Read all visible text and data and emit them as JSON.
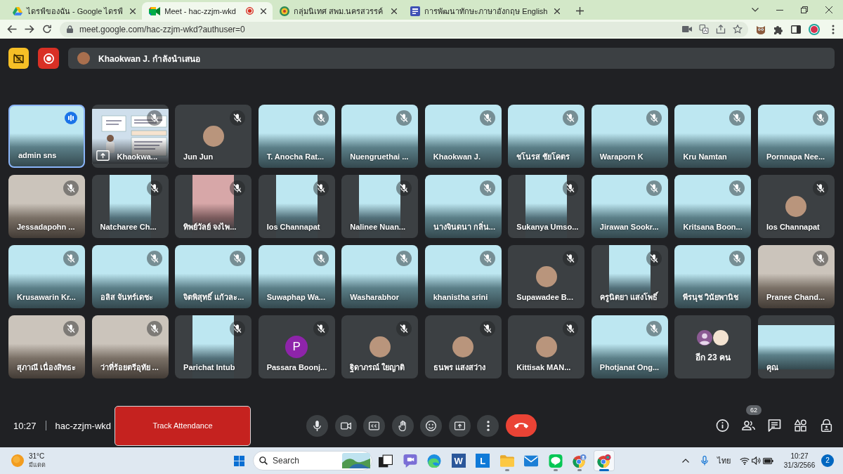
{
  "browser": {
    "tabs": [
      {
        "kind": "drive",
        "title": "ไดรฟ์ของฉัน - Google ไดรฟ์",
        "selected": false,
        "recording": false
      },
      {
        "kind": "meet",
        "title": "Meet - hac-zzjm-wkd",
        "selected": true,
        "recording": true
      },
      {
        "kind": "emblem",
        "title": "กลุ่มนิเทศ สพม.นครสวรรค์",
        "selected": false,
        "recording": false
      },
      {
        "kind": "page",
        "title": "การพัฒนาทักษะภาษาอังกฤษ English",
        "selected": false,
        "recording": false
      }
    ],
    "address": "meet.google.com/hac-zzjm-wkd?authuser=0"
  },
  "meet": {
    "presenter_banner": "Khaokwan J. กำลังนำเสนอ",
    "tiles": [
      {
        "name": "admin sns",
        "kind": "video",
        "virtual_background": true,
        "muted": false,
        "speaking": true
      },
      {
        "name": "Khaokwa...",
        "kind": "presentation",
        "muted": true,
        "speaking": false
      },
      {
        "name": "Jun Jun",
        "kind": "avatar",
        "muted": true,
        "speaking": false
      },
      {
        "name": "T. Anocha Rat...",
        "kind": "video",
        "virtual_background": true,
        "muted": true,
        "speaking": false
      },
      {
        "name": "Nuengruethai ...",
        "kind": "video",
        "virtual_background": true,
        "muted": true,
        "speaking": false
      },
      {
        "name": "Khaokwan J.",
        "kind": "video",
        "virtual_background": true,
        "muted": true,
        "speaking": false
      },
      {
        "name": "ชโนรส ชัยโคตร",
        "kind": "video",
        "virtual_background": true,
        "muted": true,
        "speaking": false
      },
      {
        "name": "Waraporn K",
        "kind": "video",
        "virtual_background": true,
        "muted": true,
        "speaking": false
      },
      {
        "name": "Kru Namtan",
        "kind": "video",
        "virtual_background": true,
        "muted": true,
        "speaking": false
      },
      {
        "name": "Pornnapa Nee...",
        "kind": "video",
        "virtual_background": true,
        "muted": true,
        "speaking": false
      },
      {
        "name": "Jessadapohn ...",
        "kind": "video",
        "virtual_background": false,
        "muted": true,
        "speaking": false
      },
      {
        "name": "Natcharee Ch...",
        "kind": "video-narrow",
        "virtual_background": true,
        "muted": true,
        "speaking": false
      },
      {
        "name": "ทิพย์วัลย์ จงไพ...",
        "kind": "video-narrow",
        "virtual_background": false,
        "muted": true,
        "speaking": false
      },
      {
        "name": "Ios Channapat",
        "kind": "video-narrow",
        "virtual_background": true,
        "muted": true,
        "speaking": false
      },
      {
        "name": "Nalinee Nuan...",
        "kind": "video-narrow",
        "virtual_background": true,
        "muted": true,
        "speaking": false
      },
      {
        "name": "นางจินดนา กลิ่น...",
        "kind": "video",
        "virtual_background": true,
        "muted": true,
        "speaking": false
      },
      {
        "name": "Sukanya Umso...",
        "kind": "video-narrow",
        "virtual_background": true,
        "muted": true,
        "speaking": false
      },
      {
        "name": "Jirawan Sookr...",
        "kind": "video",
        "virtual_background": true,
        "muted": true,
        "speaking": false
      },
      {
        "name": "Kritsana Boon...",
        "kind": "video",
        "virtual_background": true,
        "muted": true,
        "speaking": false
      },
      {
        "name": "Ios Channapat",
        "kind": "avatar",
        "muted": true,
        "speaking": false
      },
      {
        "name": "Krusawarin Kr...",
        "kind": "video",
        "virtual_background": true,
        "muted": true,
        "speaking": false
      },
      {
        "name": "อลิส จันทร์เดชะ",
        "kind": "video",
        "virtual_background": true,
        "muted": true,
        "speaking": false
      },
      {
        "name": "จิตพิสุทธิ์ แก้วละ...",
        "kind": "video",
        "virtual_background": true,
        "muted": true,
        "speaking": false
      },
      {
        "name": "Suwaphap Wa...",
        "kind": "video",
        "virtual_background": true,
        "muted": true,
        "speaking": false
      },
      {
        "name": "Washarabhor",
        "kind": "video",
        "virtual_background": true,
        "muted": true,
        "speaking": false
      },
      {
        "name": "khanistha srini",
        "kind": "video",
        "virtual_background": true,
        "muted": true,
        "speaking": false
      },
      {
        "name": "Supawadee B...",
        "kind": "avatar",
        "muted": true,
        "speaking": false
      },
      {
        "name": "ครูนิตยา แสงโพธิ์",
        "kind": "video-narrow",
        "virtual_background": true,
        "muted": true,
        "speaking": false
      },
      {
        "name": "พีรนุช วินัยพานิช",
        "kind": "video",
        "virtual_background": true,
        "muted": true,
        "speaking": false
      },
      {
        "name": "Pranee Chand...",
        "kind": "video",
        "virtual_background": false,
        "muted": true,
        "speaking": false
      },
      {
        "name": "สุภาณี เนื่องสิทธะ",
        "kind": "video",
        "virtual_background": false,
        "muted": true,
        "speaking": false
      },
      {
        "name": "ว่าที่ร้อยตรีอุทัย ...",
        "kind": "video",
        "virtual_background": false,
        "muted": true,
        "speaking": false
      },
      {
        "name": "Parichat Intub",
        "kind": "video-narrow",
        "virtual_background": true,
        "muted": true,
        "speaking": false
      },
      {
        "name": "Passara Boonj...",
        "kind": "letter",
        "initial": "P",
        "muted": true,
        "speaking": false
      },
      {
        "name": "ฐิดาภรณ์ ใยญาติ",
        "kind": "avatar",
        "muted": true,
        "speaking": false
      },
      {
        "name": "ธนพร แสงสว่าง",
        "kind": "avatar",
        "muted": true,
        "speaking": false
      },
      {
        "name": "Kittisak MAN...",
        "kind": "avatar",
        "muted": true,
        "speaking": false
      },
      {
        "name": "Photjanat Ong...",
        "kind": "video",
        "virtual_background": true,
        "muted": true,
        "speaking": false
      },
      {
        "name": "อีก 23 คน",
        "kind": "overflow",
        "muted": false,
        "speaking": false
      },
      {
        "name": "คุณ",
        "kind": "video-letterbox",
        "virtual_background": true,
        "muted": false,
        "speaking": false
      }
    ],
    "footer": {
      "time": "10:27",
      "meeting_code": "hac-zzjm-wkd",
      "attendance_button": "Track Attendance",
      "people_count": "62"
    }
  },
  "taskbar": {
    "weather": {
      "temperature": "31°C",
      "condition": "มีแดด"
    },
    "search": {
      "placeholder": "Search"
    },
    "apps": [
      {
        "kind": "task-view",
        "running": false,
        "selected": false
      },
      {
        "kind": "chat",
        "running": false,
        "selected": false
      },
      {
        "kind": "swirl",
        "running": false,
        "selected": false
      },
      {
        "kind": "word",
        "letter": "W",
        "running": false,
        "selected": false
      },
      {
        "kind": "letter",
        "letter": "L",
        "running": false,
        "selected": false
      },
      {
        "kind": "folder",
        "running": true,
        "selected": false
      },
      {
        "kind": "mail",
        "running": false,
        "selected": false
      },
      {
        "kind": "bubble",
        "running": true,
        "selected": false
      },
      {
        "kind": "browser-profile",
        "running": true,
        "selected": false
      },
      {
        "kind": "browser",
        "running": true,
        "selected": true
      }
    ],
    "language": "ไทย",
    "time": "10:27",
    "date": "31/3/2566",
    "notification_count": "2"
  }
}
